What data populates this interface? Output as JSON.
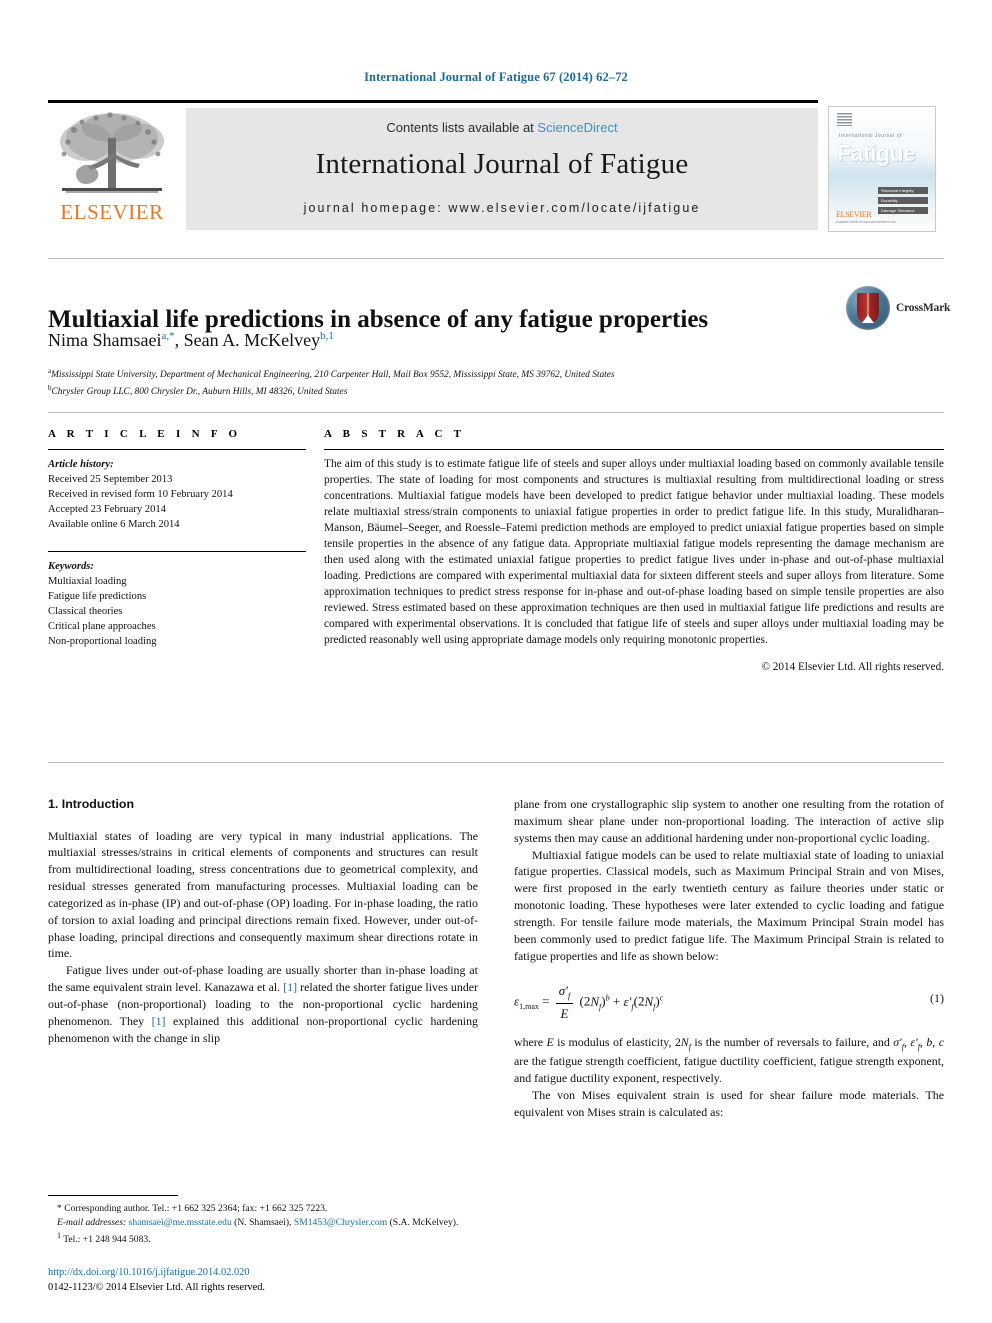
{
  "running_head": "International Journal of Fatigue 67 (2014) 62–72",
  "masthead": {
    "contents_prefix": "Contents lists available at ",
    "sciencedirect": "ScienceDirect",
    "journal_title": "International Journal of Fatigue",
    "homepage": "journal homepage: www.elsevier.com/locate/ijfatigue",
    "publisher_wordmark": "ELSEVIER"
  },
  "cover": {
    "small_title": "International Journal of",
    "big_title": "Fatigue",
    "bars": [
      "Structural Integrity",
      "Durability",
      "Damage Tolerance"
    ],
    "footer_logo": "ELSEVIER",
    "footer_sub": "Available online at www.sciencedirect.com"
  },
  "article": {
    "title": "Multiaxial life predictions in absence of any fatigue properties",
    "authors": [
      {
        "name": "Nima Shamsaei",
        "marks": "a,*"
      },
      {
        "name": "Sean A. McKelvey",
        "marks": "b,1"
      }
    ],
    "affiliations": [
      {
        "mark": "a",
        "text": "Mississippi State University, Department of Mechanical Engineering, 210 Carpenter Hall, Mail Box 9552, Mississippi State, MS 39762, United States"
      },
      {
        "mark": "b",
        "text": "Chrysler Group LLC, 800 Chrysler Dr., Auburn Hills, MI 48326, United States"
      }
    ],
    "crossmark_label": "CrossMark"
  },
  "article_info": {
    "heading": "A R T I C L E   I N F O",
    "history_label": "Article history:",
    "history": [
      "Received 25 September 2013",
      "Received in revised form 10 February 2014",
      "Accepted 23 February 2014",
      "Available online 6 March 2014"
    ],
    "keywords_label": "Keywords:",
    "keywords": [
      "Multiaxial loading",
      "Fatigue life predictions",
      "Classical theories",
      "Critical plane approaches",
      "Non-proportional loading"
    ]
  },
  "abstract": {
    "heading": "A B S T R A C T",
    "text": "The aim of this study is to estimate fatigue life of steels and super alloys under multiaxial loading based on commonly available tensile properties. The state of loading for most components and structures is multiaxial resulting from multidirectional loading or stress concentrations. Multiaxial fatigue models have been developed to predict fatigue behavior under multiaxial loading. These models relate multiaxial stress/strain components to uniaxial fatigue properties in order to predict fatigue life. In this study, Muralidharan–Manson, Bäumel–Seeger, and Roessle–Fatemi prediction methods are employed to predict uniaxial fatigue properties based on simple tensile properties in the absence of any fatigue data. Appropriate multiaxial fatigue models representing the damage mechanism are then used along with the estimated uniaxial fatigue properties to predict fatigue lives under in-phase and out-of-phase multiaxial loading. Predictions are compared with experimental multiaxial data for sixteen different steels and super alloys from literature. Some approximation techniques to predict stress response for in-phase and out-of-phase loading based on simple tensile properties are also reviewed. Stress estimated based on these approximation techniques are then used in multiaxial fatigue life predictions and results are compared with experimental observations. It is concluded that fatigue life of steels and super alloys under multiaxial loading may be predicted reasonably well using appropriate damage models only requiring monotonic properties.",
    "copyright": "© 2014 Elsevier Ltd. All rights reserved."
  },
  "body": {
    "section_heading": "1. Introduction",
    "left_paragraphs": [
      "Multiaxial states of loading are very typical in many industrial applications. The multiaxial stresses/strains in critical elements of components and structures can result from multidirectional loading, stress concentrations due to geometrical complexity, and residual stresses generated from manufacturing processes. Multiaxial loading can be categorized as in-phase (IP) and out-of-phase (OP) loading. For in-phase loading, the ratio of torsion to axial loading and principal directions remain fixed. However, under out-of-phase loading, principal directions and consequently maximum shear directions rotate in time.",
      "Fatigue lives under out-of-phase loading are usually shorter than in-phase loading at the same equivalent strain level. Kanazawa et al. [1] related the shorter fatigue lives under out-of-phase (non-proportional) loading to the non-proportional cyclic hardening phenomenon. They [1] explained this additional non-proportional cyclic hardening phenomenon with the change in slip"
    ],
    "right_paragraphs_top": [
      "plane from one crystallographic slip system to another one resulting from the rotation of maximum shear plane under non-proportional loading. The interaction of active slip systems then may cause an additional hardening under non-proportional cyclic loading.",
      "Multiaxial fatigue models can be used to relate multiaxial state of loading to uniaxial fatigue properties. Classical models, such as Maximum Principal Strain and von Mises, were first proposed in the early twentieth century as failure theories under static or monotonic loading. These hypotheses were later extended to cyclic loading and fatigue strength. For tensile failure mode materials, the Maximum Principal Strain model has been commonly used to predict fatigue life. The Maximum Principal Strain is related to fatigue properties and life as shown below:"
    ],
    "equation_number": "(1)",
    "right_paragraphs_bottom": [
      "where E is modulus of elasticity, 2Nƒ is the number of reversals to failure, and σ′ƒ, ε′ƒ, b, c are the fatigue strength coefficient, fatigue ductility coefficient, fatigue strength exponent, and fatigue ductility exponent, respectively.",
      "The von Mises equivalent strain is used for shear failure mode materials. The equivalent von Mises strain is calculated as:"
    ]
  },
  "footnotes": {
    "corresponding": "* Corresponding author. Tel.: +1 662 325 2364; fax: +1 662 325 7223.",
    "email_label": "E-mail addresses:",
    "email1": "shamsaei@me.msstate.edu",
    "email1_owner": "(N. Shamsaei),",
    "email2": "SM1453@Chrysler.com",
    "email2_owner": "(S.A. McKelvey).",
    "tel_note": "Tel.: +1 248 944 5083.",
    "tel_mark": "1"
  },
  "doi": {
    "url": "http://dx.doi.org/10.1016/j.ijfatigue.2014.02.020",
    "issn_line": "0142-1123/© 2014 Elsevier Ltd. All rights reserved."
  },
  "colors": {
    "link_blue": "#1a6ba0",
    "sciencedirect_blue": "#3d8fc4",
    "elsevier_orange": "#e87722",
    "panel_grey": "#e6e6e6"
  }
}
